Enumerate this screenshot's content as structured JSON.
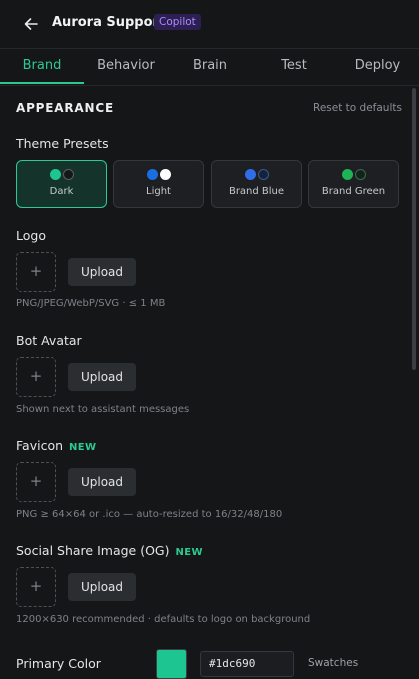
{
  "header": {
    "back_icon": "arrow-left-icon",
    "title": "Aurora Support",
    "badge": "Copilot",
    "badge_color": "#a88bff"
  },
  "tabs": [
    {
      "label": "Brand",
      "active": true
    },
    {
      "label": "Behavior",
      "active": false
    },
    {
      "label": "Brain",
      "active": false
    },
    {
      "label": "Test",
      "active": false
    },
    {
      "label": "Deploy",
      "active": false
    }
  ],
  "appearance": {
    "title": "APPEARANCE",
    "reset_label": "Reset to defaults"
  },
  "theme_presets": {
    "label": "Theme Presets",
    "selected": "Dark",
    "items": [
      {
        "name": "Dark",
        "colors": [
          "#1dc690",
          "#141618"
        ]
      },
      {
        "name": "Light",
        "colors": [
          "#1a6fe0",
          "#ffffff"
        ]
      },
      {
        "name": "Brand Blue",
        "colors": [
          "#2f6ee8",
          "#14233d"
        ]
      },
      {
        "name": "Brand Green",
        "colors": [
          "#1db457",
          "#12231a"
        ]
      }
    ]
  },
  "logo": {
    "label": "Logo",
    "upload_label": "Upload",
    "placeholder_icon": "+",
    "helper": "PNG/JPEG/WebP/SVG · ≤ 1 MB"
  },
  "bot_avatar": {
    "label": "Bot Avatar",
    "upload_label": "Upload",
    "placeholder_icon": "+",
    "helper": "Shown next to assistant messages"
  },
  "favicon": {
    "label": "Favicon",
    "new_tag": "NEW",
    "upload_label": "Upload",
    "placeholder_icon": "+",
    "helper": "PNG ≥ 64×64 or .ico — auto-resized to 16/32/48/180"
  },
  "og_image": {
    "label": "Social Share Image (OG)",
    "new_tag": "NEW",
    "upload_label": "Upload",
    "placeholder_icon": "+",
    "helper": "1200×630 recommended · defaults to logo on background"
  },
  "primary_color": {
    "label": "Primary Color",
    "value": "#1dc690",
    "swatches_label": "Swatches"
  },
  "accent_color": "#2ec990"
}
